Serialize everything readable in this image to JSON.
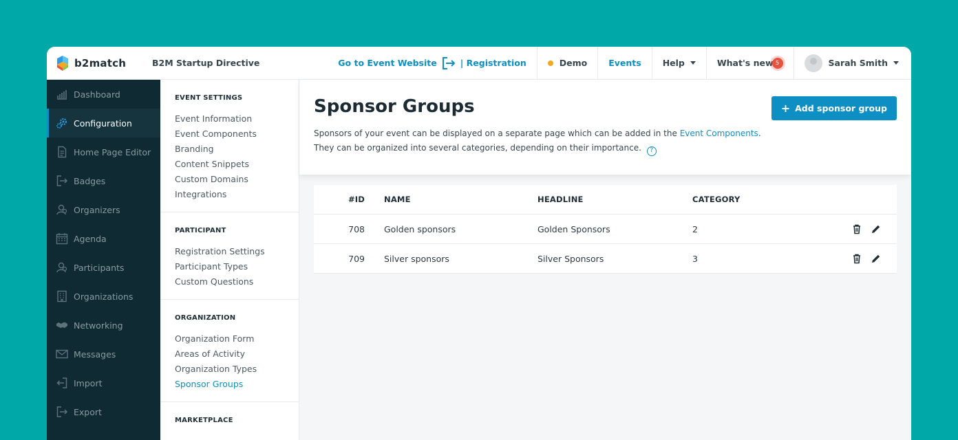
{
  "brand": {
    "name": "b2match",
    "colors": {
      "accent": "#0d8fc4",
      "background": "#00a8a8",
      "sidebar": "#0f2a33",
      "status_dot": "#f5a623",
      "badge": "#e8533f"
    }
  },
  "header": {
    "event_name": "B2M Startup Directive",
    "go_to_website": "Go to Event Website",
    "registration": "| Registration",
    "demo": "Demo",
    "events": "Events",
    "help": "Help",
    "whats_new": "What's new",
    "whats_new_count": "5",
    "user_name": "Sarah Smith"
  },
  "sidebar": {
    "items": [
      {
        "label": "Dashboard",
        "icon": "chart-icon"
      },
      {
        "label": "Configuration",
        "icon": "gears-icon"
      },
      {
        "label": "Home Page Editor",
        "icon": "document-icon"
      },
      {
        "label": "Badges",
        "icon": "badge-arrow-icon"
      },
      {
        "label": "Organizers",
        "icon": "organizers-icon"
      },
      {
        "label": "Agenda",
        "icon": "calendar-icon"
      },
      {
        "label": "Participants",
        "icon": "participants-icon"
      },
      {
        "label": "Organizations",
        "icon": "building-icon"
      },
      {
        "label": "Networking",
        "icon": "handshake-icon"
      },
      {
        "label": "Messages",
        "icon": "envelope-icon"
      },
      {
        "label": "Import",
        "icon": "import-icon"
      },
      {
        "label": "Export",
        "icon": "export-icon"
      }
    ]
  },
  "submenu": {
    "sections": [
      {
        "title": "EVENT SETTINGS",
        "items": [
          "Event Information",
          "Event Components",
          "Branding",
          "Content Snippets",
          "Custom Domains",
          "Integrations"
        ]
      },
      {
        "title": "PARTICIPANT",
        "items": [
          "Registration Settings",
          "Participant Types",
          "Custom Questions"
        ]
      },
      {
        "title": "ORGANIZATION",
        "items": [
          "Organization Form",
          "Areas of Activity",
          "Organization Types",
          "Sponsor Groups"
        ]
      },
      {
        "title": "MARKETPLACE",
        "items": []
      }
    ]
  },
  "main": {
    "title": "Sponsor Groups",
    "desc_line1": "Sponsors of your event can be displayed on a separate page which can be added in the ",
    "desc_link": "Event Components",
    "desc_line1_end": ".",
    "desc_line2": "They can be organized into several categories, depending on their importance.",
    "help_glyph": "?",
    "add_button": "Add sponsor group",
    "table": {
      "columns": [
        "#ID",
        "NAME",
        "HEADLINE",
        "CATEGORY"
      ],
      "rows": [
        {
          "id": "708",
          "name": "Golden sponsors",
          "headline": "Golden Sponsors",
          "category": "2"
        },
        {
          "id": "709",
          "name": "Silver sponsors",
          "headline": "Silver Sponsors",
          "category": "3"
        }
      ]
    }
  }
}
